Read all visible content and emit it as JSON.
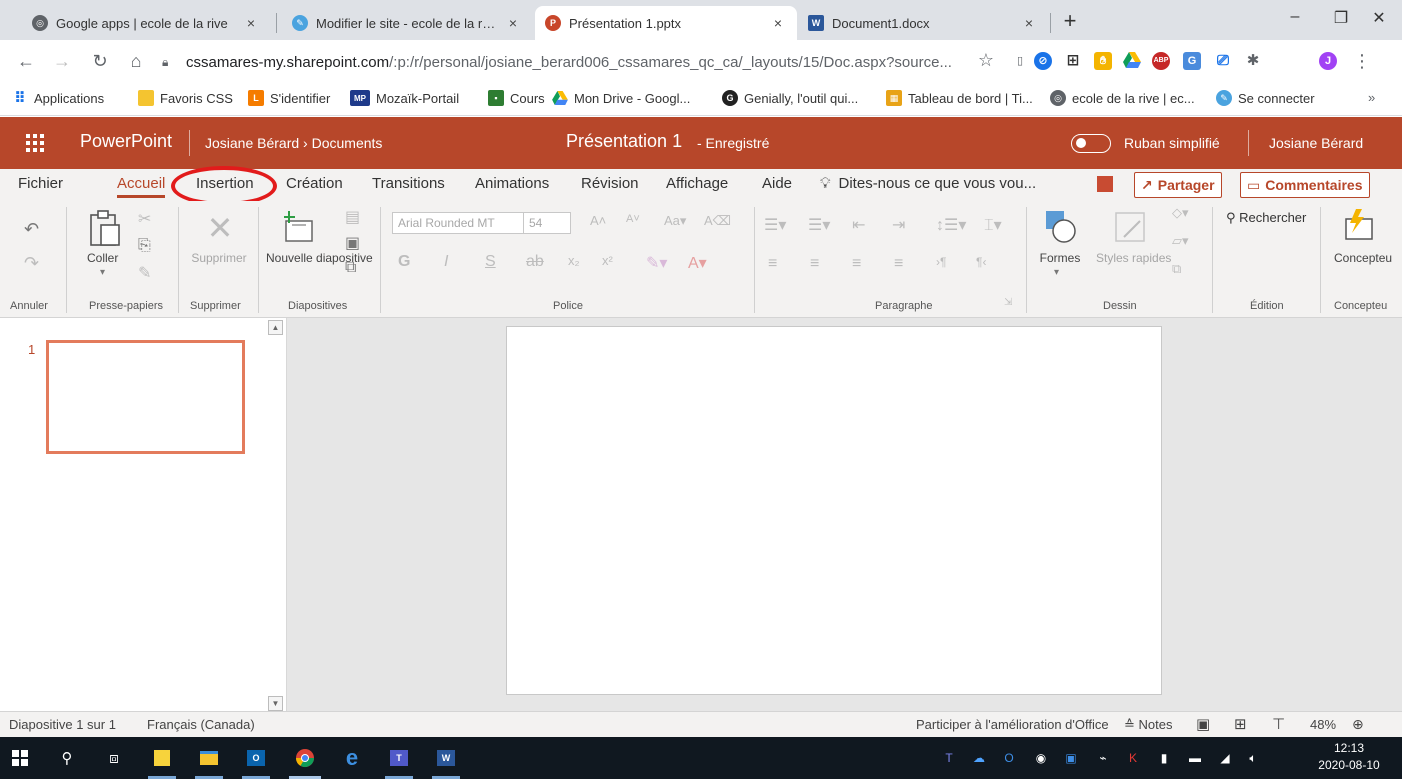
{
  "browser": {
    "tabs": [
      {
        "title": "Google apps | ecole de la rive",
        "close": "×"
      },
      {
        "title": "Modifier le site - ecole de la rive",
        "close": "×"
      },
      {
        "title": "Présentation 1.pptx",
        "close": "×"
      },
      {
        "title": "Document1.docx",
        "close": "×"
      }
    ],
    "new_tab": "+",
    "window_controls": {
      "minimize": "–",
      "maximize": "❐",
      "close": "✕"
    },
    "address": {
      "host": "cssamares-my.sharepoint.com",
      "path": "/:p:/r/personal/josiane_berard006_cssamares_qc_ca/_layouts/15/Doc.aspx?source..."
    },
    "bookmarks": [
      "Applications",
      "Favoris CSS",
      "S'identifier",
      "Mozaïk-Portail",
      "Cours",
      "Mon Drive - Googl...",
      "Genially, l'outil qui...",
      "Tableau de bord | Ti...",
      "ecole de la rive | ec...",
      "Se connecter"
    ],
    "bookmarks_more": "»",
    "extension_badges": {
      "abp": "ABP",
      "profile": "J"
    }
  },
  "ppt": {
    "app_name": "PowerPoint",
    "breadcrumb": "Josiane Bérard › Documents",
    "doc_title": "Présentation 1",
    "save_state": "-  Enregistré",
    "simplified_ribbon": "Ruban simplifié",
    "user_name": "Josiane Bérard",
    "ribbon_tabs": [
      "Fichier",
      "Accueil",
      "Insertion",
      "Création",
      "Transitions",
      "Animations",
      "Révision",
      "Affichage",
      "Aide"
    ],
    "active_tab": "Accueil",
    "tell_me": "Dites-nous ce que vous vou...",
    "share": "Partager",
    "comments": "Commentaires",
    "ribbon": {
      "paste": "Coller",
      "delete": "Supprimer",
      "new_slide": "Nouvelle diapositive",
      "font_name": "Arial Rounded MT",
      "font_size": "54",
      "shapes": "Formes",
      "quick_styles": "Styles rapides",
      "search": "Rechercher",
      "designer": "Concepteu",
      "groups": [
        "Annuler",
        "Presse-papiers",
        "Supprimer",
        "Diapositives",
        "Police",
        "Paragraphe",
        "Dessin",
        "Édition",
        "Concepteu"
      ]
    },
    "slide_number": "1",
    "status": {
      "slide_count": "Diapositive 1 sur 1",
      "language": "Français (Canada)",
      "improve": "Participer à l'amélioration d'Office",
      "notes": "Notes",
      "zoom": "48%"
    }
  },
  "taskbar": {
    "time": "12:13",
    "date": "2020-08-10"
  }
}
